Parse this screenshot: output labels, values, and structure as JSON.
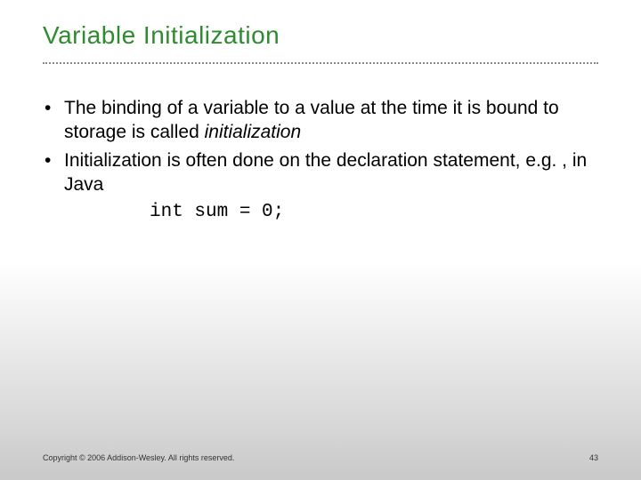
{
  "title": "Variable Initialization",
  "bullets": [
    {
      "text_before": "The binding of a variable to a value at the time it is bound to storage is called ",
      "emphasis": "initialization",
      "text_after": ""
    },
    {
      "text_before": "Initialization is often done on the declaration statement, e.g. , in Java",
      "emphasis": "",
      "text_after": ""
    }
  ],
  "code_line": "int sum = 0;",
  "footer": {
    "copyright": "Copyright © 2006 Addison-Wesley. All rights reserved.",
    "page_number": "43"
  }
}
